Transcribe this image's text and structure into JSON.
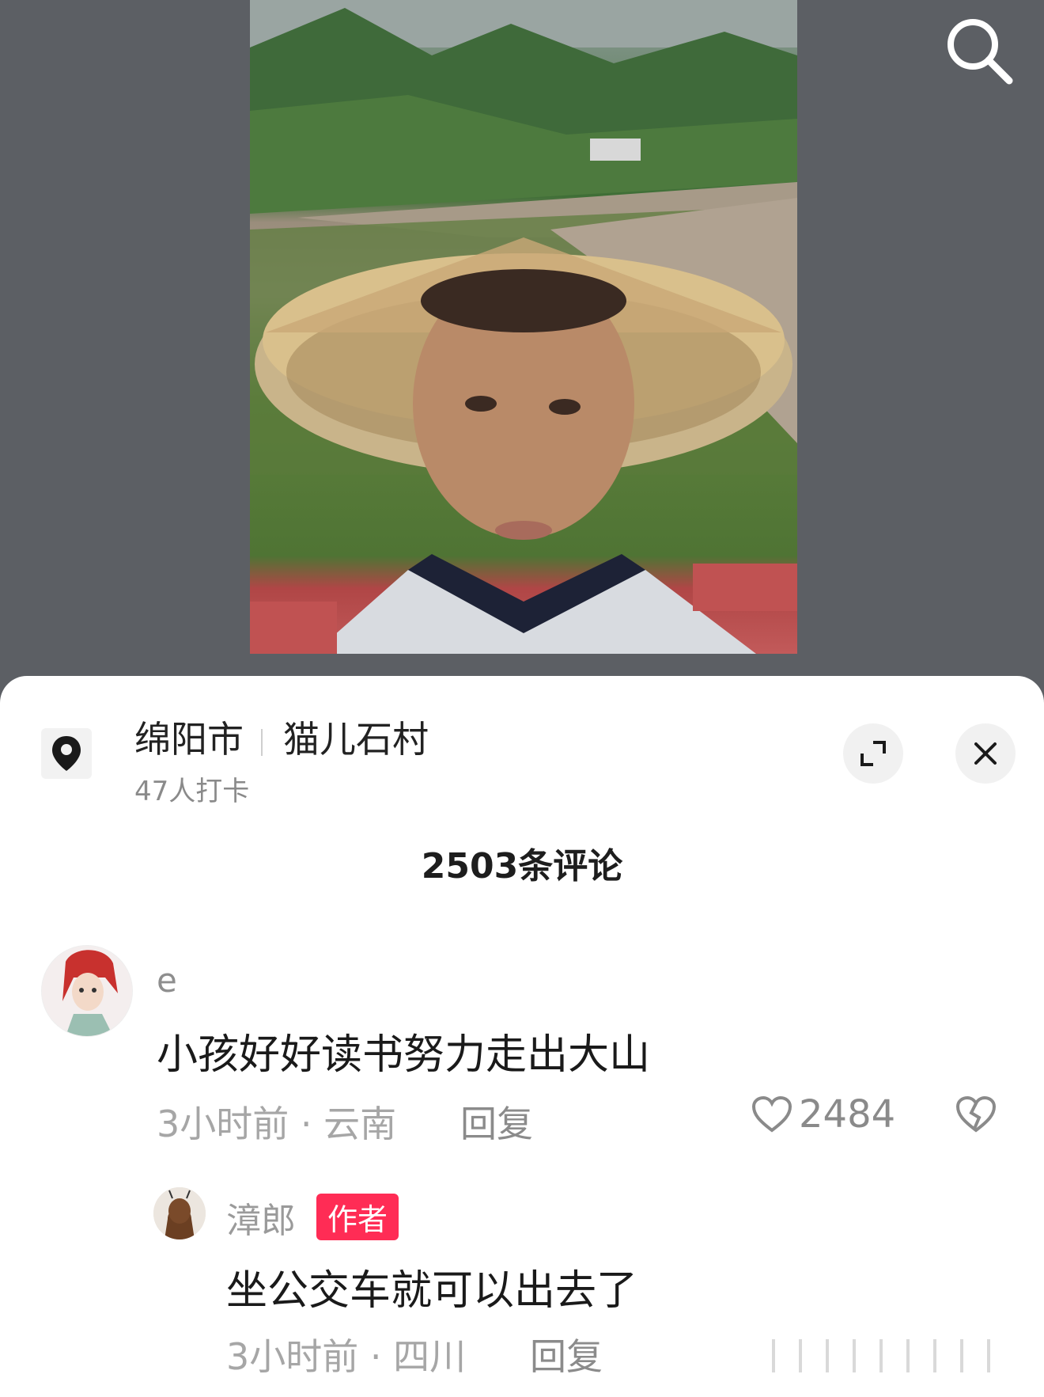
{
  "location": {
    "city": "绵阳市",
    "place": "猫儿石村",
    "checkins": "47人打卡"
  },
  "comments_header": "2503条评论",
  "comments": [
    {
      "user": "e",
      "text": "小孩好好读书努力走出大山",
      "meta": "3小时前 · 云南",
      "reply_label": "回复",
      "likes": "2484",
      "replies": [
        {
          "user": "漳郎",
          "badge": "作者",
          "text": "坐公交车就可以出去了",
          "meta": "3小时前 · 四川",
          "reply_label": "回复"
        }
      ]
    }
  ],
  "icons": {
    "search": "search-icon",
    "location": "location-pin-icon",
    "expand": "expand-icon",
    "close": "close-icon",
    "like": "heart-icon",
    "dislike": "broken-heart-icon"
  },
  "colors": {
    "author_badge": "#ff2c55",
    "backdrop": "#5c5f64"
  }
}
